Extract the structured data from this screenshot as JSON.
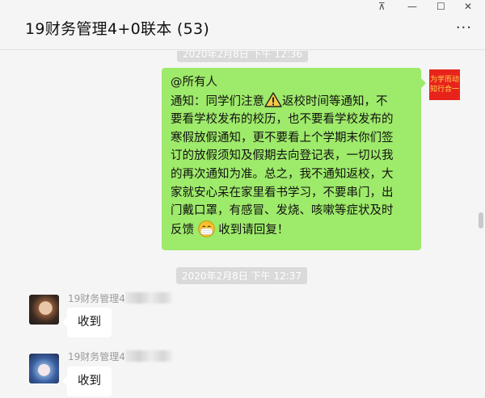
{
  "window": {
    "title": "19财务管理4+0联本 (53)",
    "more_label": "...",
    "controls": {
      "pin": "⊼",
      "minimize": "—",
      "maximize": "☐",
      "close": "✕"
    }
  },
  "messages": {
    "top_timestamp": "2020年2月8日 下午 12:36",
    "outgoing": {
      "lines": [
        "@所有人",
        "通知：同学们注意",
        "返校时间等通知，不",
        "要看学校发布的校历，也不要看学校发布的",
        "寒假放假通知，更不要看上个学期末你们签",
        "订的放假须知及假期去向登记表，一切以我",
        "的再次通知为准。总之，我不通知返校，大",
        "家就安心呆在家里看书学习，不要串门，出",
        "门戴口罩，有感冒、发烧、咳嗽等症状及时",
        "反馈",
        "收到请回复！"
      ],
      "icons": [
        "warning-icon",
        "mask-face-emoji"
      ],
      "avatar_text": [
        "为学而动",
        "知行合一"
      ]
    },
    "mid_timestamp": "2020年2月8日 下午 12:37",
    "incoming": [
      {
        "sender": "19财务管理4",
        "text": "收到"
      },
      {
        "sender": "19财务管理4",
        "text": "收到"
      }
    ]
  },
  "colors": {
    "outgoing_bubble": "#9eea6a",
    "incoming_bubble": "#ffffff",
    "background": "#f5f5f5",
    "timestamp_bg": "#dadada",
    "avatar_me": "#e8231c"
  }
}
